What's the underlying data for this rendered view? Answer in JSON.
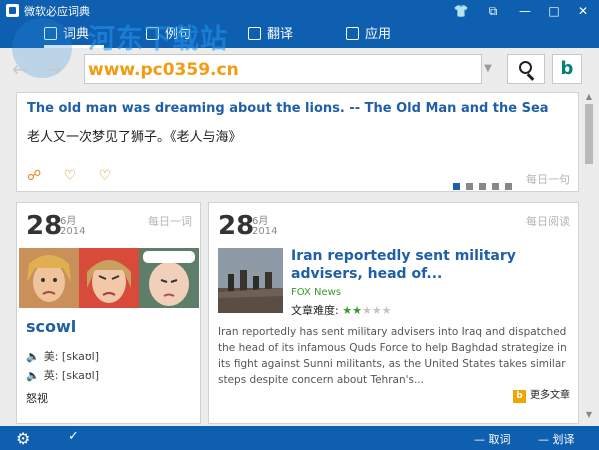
{
  "window": {
    "title": "微软必应词典",
    "controls": [
      "shirt-icon",
      "restore-icon",
      "minimize-icon",
      "maximize-icon",
      "close-icon"
    ]
  },
  "watermark": {
    "text": "河东下载站",
    "url": "www.pc0359.cn"
  },
  "nav": {
    "tabs": [
      {
        "label": "词典",
        "icon": "book-icon",
        "active": true
      },
      {
        "label": "例句",
        "icon": "list-icon",
        "active": false
      },
      {
        "label": "翻译",
        "icon": "translate-icon",
        "active": false
      },
      {
        "label": "应用",
        "icon": "apps-icon",
        "active": false
      }
    ]
  },
  "search": {
    "value": "",
    "placeholder": ""
  },
  "daily_sentence": {
    "english": "The old man was dreaming about the lions. -- The Old Man and the Sea",
    "chinese": "老人又一次梦见了狮子。《老人与海》",
    "tag": "每日一句",
    "dots": 5,
    "active_dot": 0
  },
  "word_card": {
    "day": "28",
    "month": "6月",
    "year": "2014",
    "tag": "每日一词",
    "word": "scowl",
    "pron_us_label": "美:",
    "pron_us": "[skaʊl]",
    "pron_uk_label": "英:",
    "pron_uk": "[skaʊl]",
    "meaning": "怒视"
  },
  "article_card": {
    "day": "28",
    "month": "6月",
    "year": "2014",
    "tag": "每日阅读",
    "title": "Iran reportedly sent military advisers, head of...",
    "source": "FOX News",
    "difficulty_label": "文章难度:",
    "difficulty": 2,
    "difficulty_max": 5,
    "summary": "Iran reportedly has sent military advisers into Iraq and dispatched the head of its infamous Quds Force to help Baghdad strategize in its fight against Sunni militants, as the United States takes similar steps despite concern about Tehran's...",
    "more_label": "更多文章"
  },
  "bottom": {
    "mode1": "取词",
    "mode2": "划译"
  },
  "colors": {
    "brand": "#0f5fb0",
    "link": "#1f5fa8",
    "accent": "#e6841c",
    "green": "#3a9a2e"
  }
}
